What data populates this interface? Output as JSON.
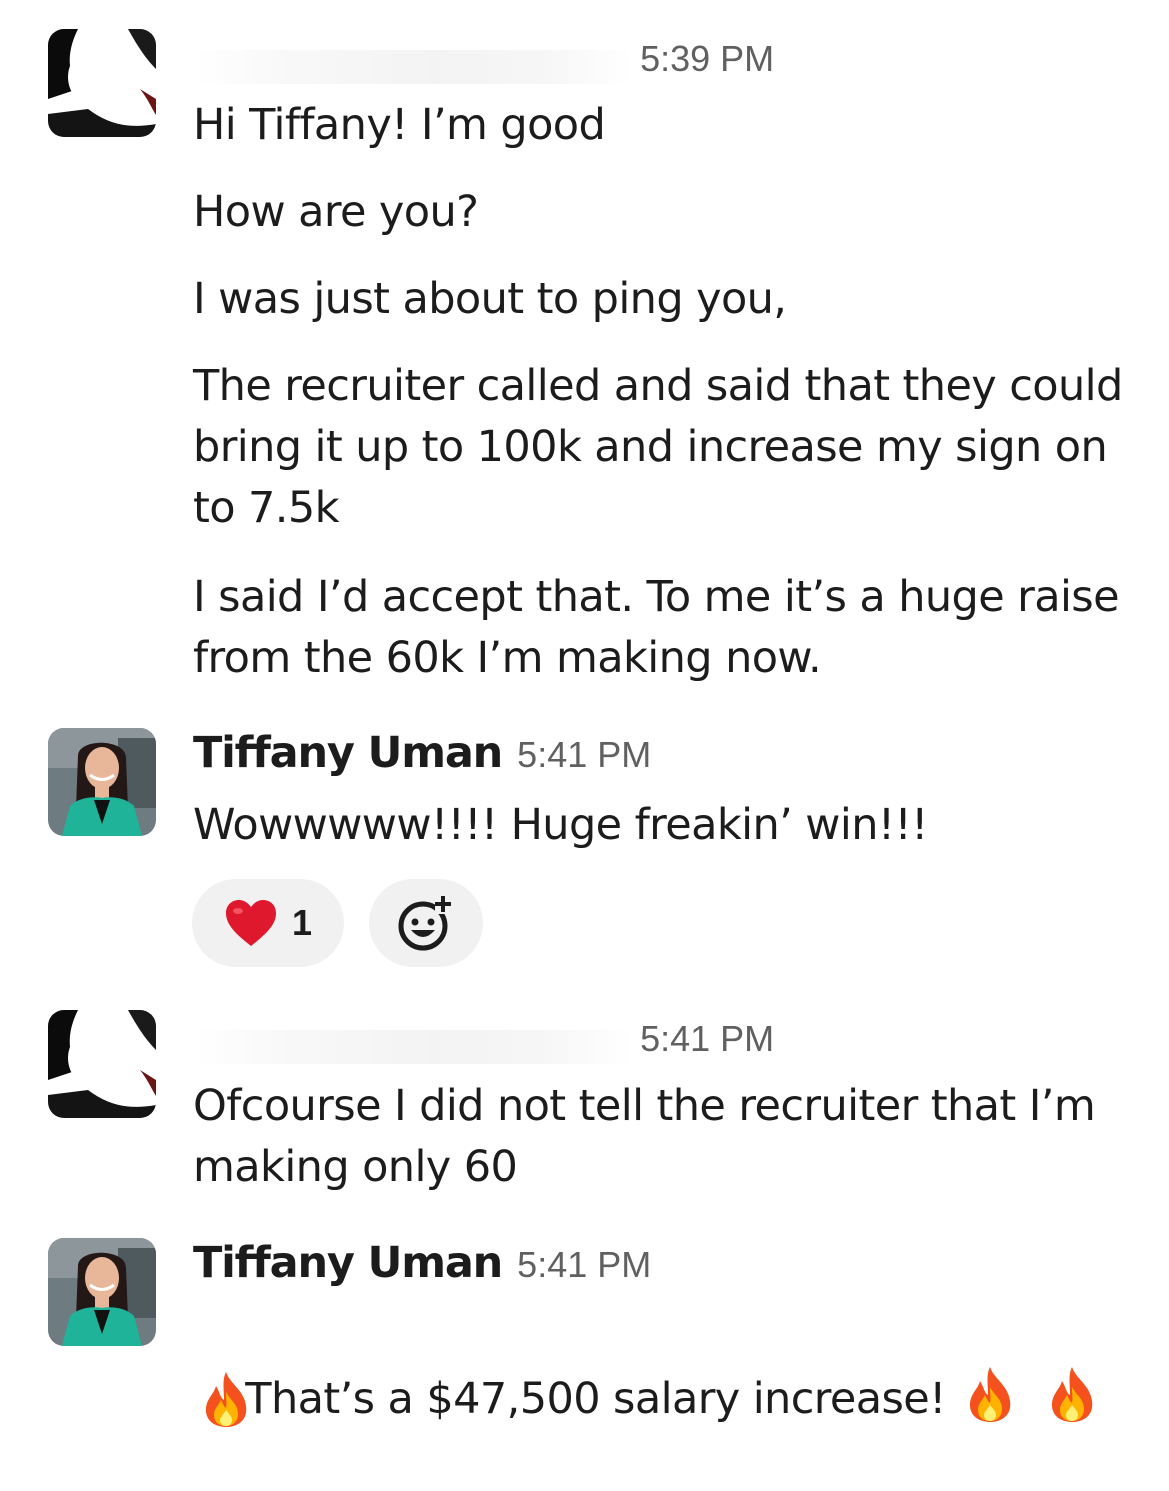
{
  "messages": [
    {
      "sender": "",
      "time": "5:39 PM",
      "lines": [
        "Hi Tiffany! I’m good",
        "How are you?",
        "I was just about to ping you,",
        "The recruiter called and said that they could bring it up to 100k and increase my sign on to 7.5k",
        "I said I’d accept that. To me it’s a huge raise from the 60k I’m making now."
      ]
    },
    {
      "sender": "Tiffany Uman",
      "time": "5:41 PM",
      "lines": [
        "Wowwwww!!!! Huge freakin’ win!!!"
      ],
      "reactions": [
        {
          "emoji": "heart-emoji",
          "count": "1"
        },
        {
          "emoji": "add-reaction-icon",
          "count": ""
        }
      ]
    },
    {
      "sender": "",
      "time": "5:41 PM",
      "lines": [
        "Ofcourse I did not tell the recruiter that I’m making only 60"
      ]
    },
    {
      "sender": "Tiffany Uman",
      "time": "5:41 PM",
      "lines": [
        "That’s a $47,500 salary increase!"
      ],
      "emojis": [
        "fire-emoji",
        "fire-emoji",
        "fire-emoji"
      ]
    }
  ],
  "colors": {
    "text": "#1d1c1d",
    "timestamp": "#616061",
    "reaction_bg": "#f1f1f1",
    "heart": "#e0182d",
    "blazer": "#1fb39a"
  }
}
